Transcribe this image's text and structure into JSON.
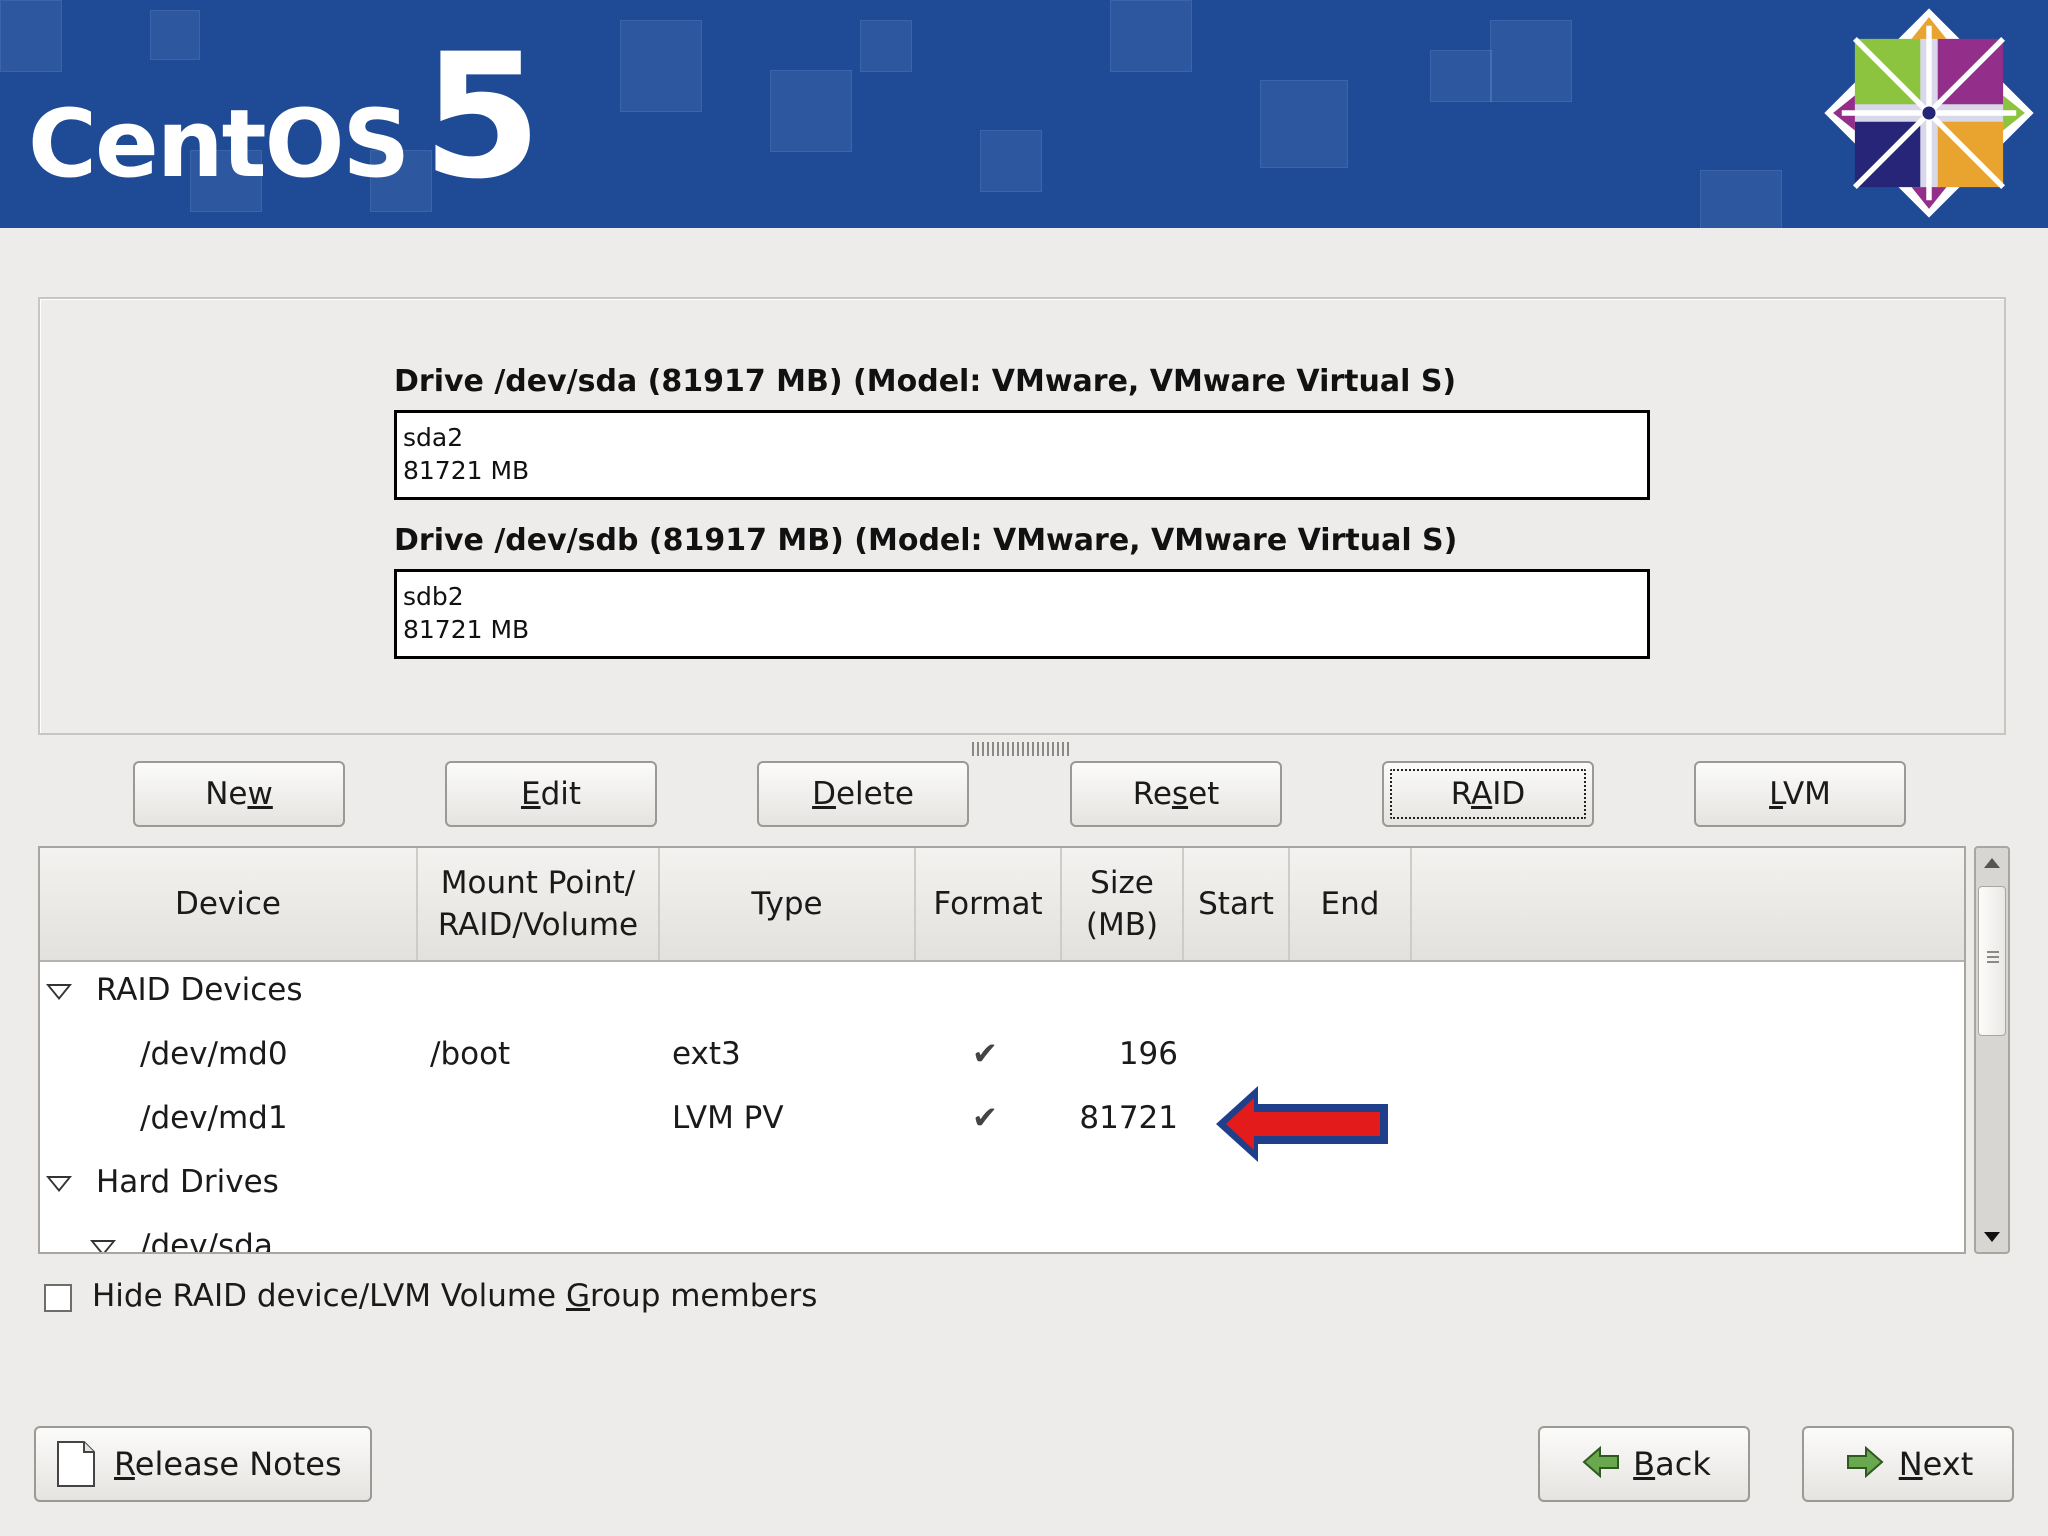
{
  "header": {
    "logo_word": "CentOS",
    "logo_number": "5",
    "colors": {
      "banner": "#1f4a95",
      "logo_green": "#8dc43f",
      "logo_purple": "#932f8a",
      "logo_orange": "#e9a32f",
      "logo_navy": "#262577"
    }
  },
  "drives": [
    {
      "title": "Drive /dev/sda (81917 MB) (Model: VMware, VMware Virtual S)",
      "partition": "sda2",
      "size": "81721 MB"
    },
    {
      "title": "Drive /dev/sdb (81917 MB) (Model: VMware, VMware Virtual S)",
      "partition": "sdb2",
      "size": "81721 MB"
    }
  ],
  "toolbar": {
    "new": {
      "pre": "Ne",
      "u": "w",
      "post": ""
    },
    "edit": {
      "pre": "",
      "u": "E",
      "post": "dit"
    },
    "delete": {
      "pre": "",
      "u": "D",
      "post": "elete"
    },
    "reset": {
      "pre": "Re",
      "u": "s",
      "post": "et"
    },
    "raid": {
      "pre": "R",
      "u": "A",
      "post": "ID"
    },
    "lvm": {
      "pre": "",
      "u": "L",
      "post": "VM"
    }
  },
  "table": {
    "headers": {
      "device": "Device",
      "mount_1": "Mount Point/",
      "mount_2": "RAID/Volume",
      "type": "Type",
      "format": "Format",
      "size_1": "Size",
      "size_2": "(MB)",
      "start": "Start",
      "end": "End"
    },
    "groups": {
      "raid": "RAID Devices",
      "hard": "Hard Drives"
    },
    "rows": [
      {
        "device": "/dev/md0",
        "mount": "/boot",
        "type": "ext3",
        "format": "✔",
        "size": "196"
      },
      {
        "device": "/dev/md1",
        "mount": "",
        "type": "LVM PV",
        "format": "✔",
        "size": "81721"
      }
    ],
    "partial_row": "/dev/sda"
  },
  "annotation": {
    "arrow_color": "#e41b1b",
    "arrow_outline": "#1f3f8a"
  },
  "options": {
    "hide_members": {
      "pre": "Hide RAID device/LVM Volume ",
      "u": "G",
      "post": "roup members",
      "checked": false
    }
  },
  "footer": {
    "release_notes": {
      "pre": "",
      "u": "R",
      "post": "elease Notes"
    },
    "back": {
      "pre": "",
      "u": "B",
      "post": "ack"
    },
    "next": {
      "pre": "",
      "u": "N",
      "post": "ext"
    }
  }
}
